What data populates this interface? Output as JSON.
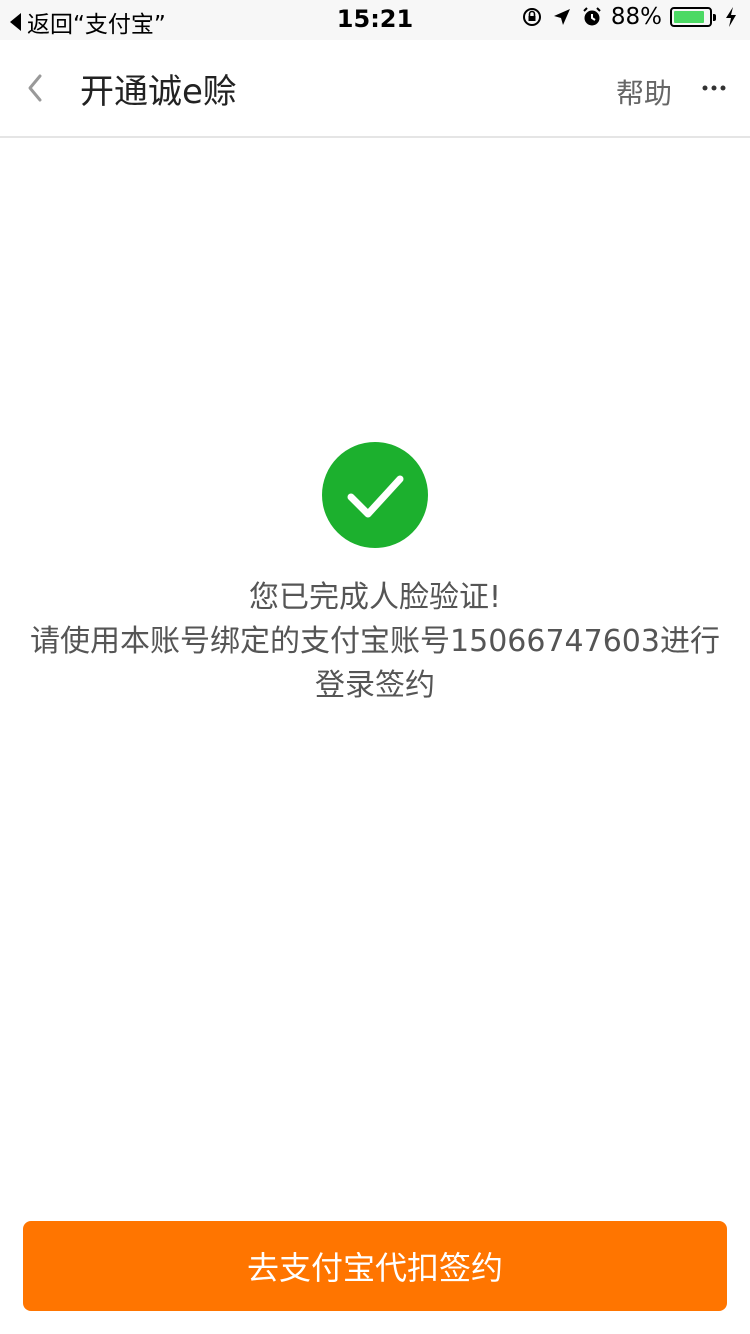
{
  "status_bar": {
    "back_label": "返回“支付宝”",
    "time": "15:21",
    "battery_percent": "88%",
    "battery_level": 0.88,
    "icons": [
      "rotation-lock-icon",
      "location-arrow-icon",
      "alarm-icon",
      "battery-icon",
      "charging-bolt-icon"
    ]
  },
  "nav": {
    "title": "开通诚e赊",
    "help_label": "帮助",
    "icons": [
      "chevron-left-icon",
      "more-icon"
    ]
  },
  "result": {
    "icon": "check-circle-icon",
    "accent_color": "#1cb02e",
    "line1": "您已完成人脸验证!",
    "line2": "请使用本账号绑定的支付宝账号15066747603进行登录签约"
  },
  "action": {
    "button_label": "去支付宝代扣签约",
    "button_color": "#ff7500"
  }
}
